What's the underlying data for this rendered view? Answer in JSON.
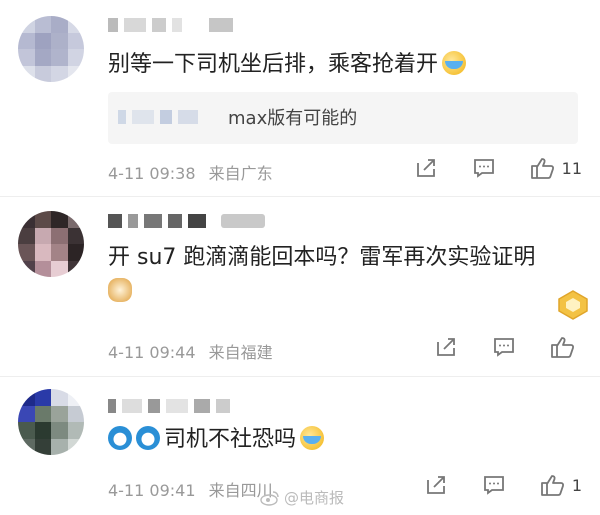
{
  "comments": [
    {
      "text": "别等一下司机坐后排，乘客抢着开",
      "emoji": "laugh-cry-icon",
      "reply": {
        "text": "max版有可能的"
      },
      "time": "4-11 09:38",
      "location": "来自广东",
      "likes": "11"
    },
    {
      "text_line1": "开 su7 跑滴滴能回本吗？雷军再次实验证明",
      "emoji": "doge-icon",
      "time": "4-11 09:44",
      "location": "来自福建",
      "likes": ""
    },
    {
      "text": "司机不社恐吗",
      "emoji": "cry-icon",
      "time": "4-11 09:41",
      "location": "来自四川",
      "likes": "1"
    }
  ],
  "watermark": "@电商报",
  "colors": {
    "meta": "#999999",
    "reply_bg": "#f5f5f5",
    "badge": "#f1b43c"
  }
}
